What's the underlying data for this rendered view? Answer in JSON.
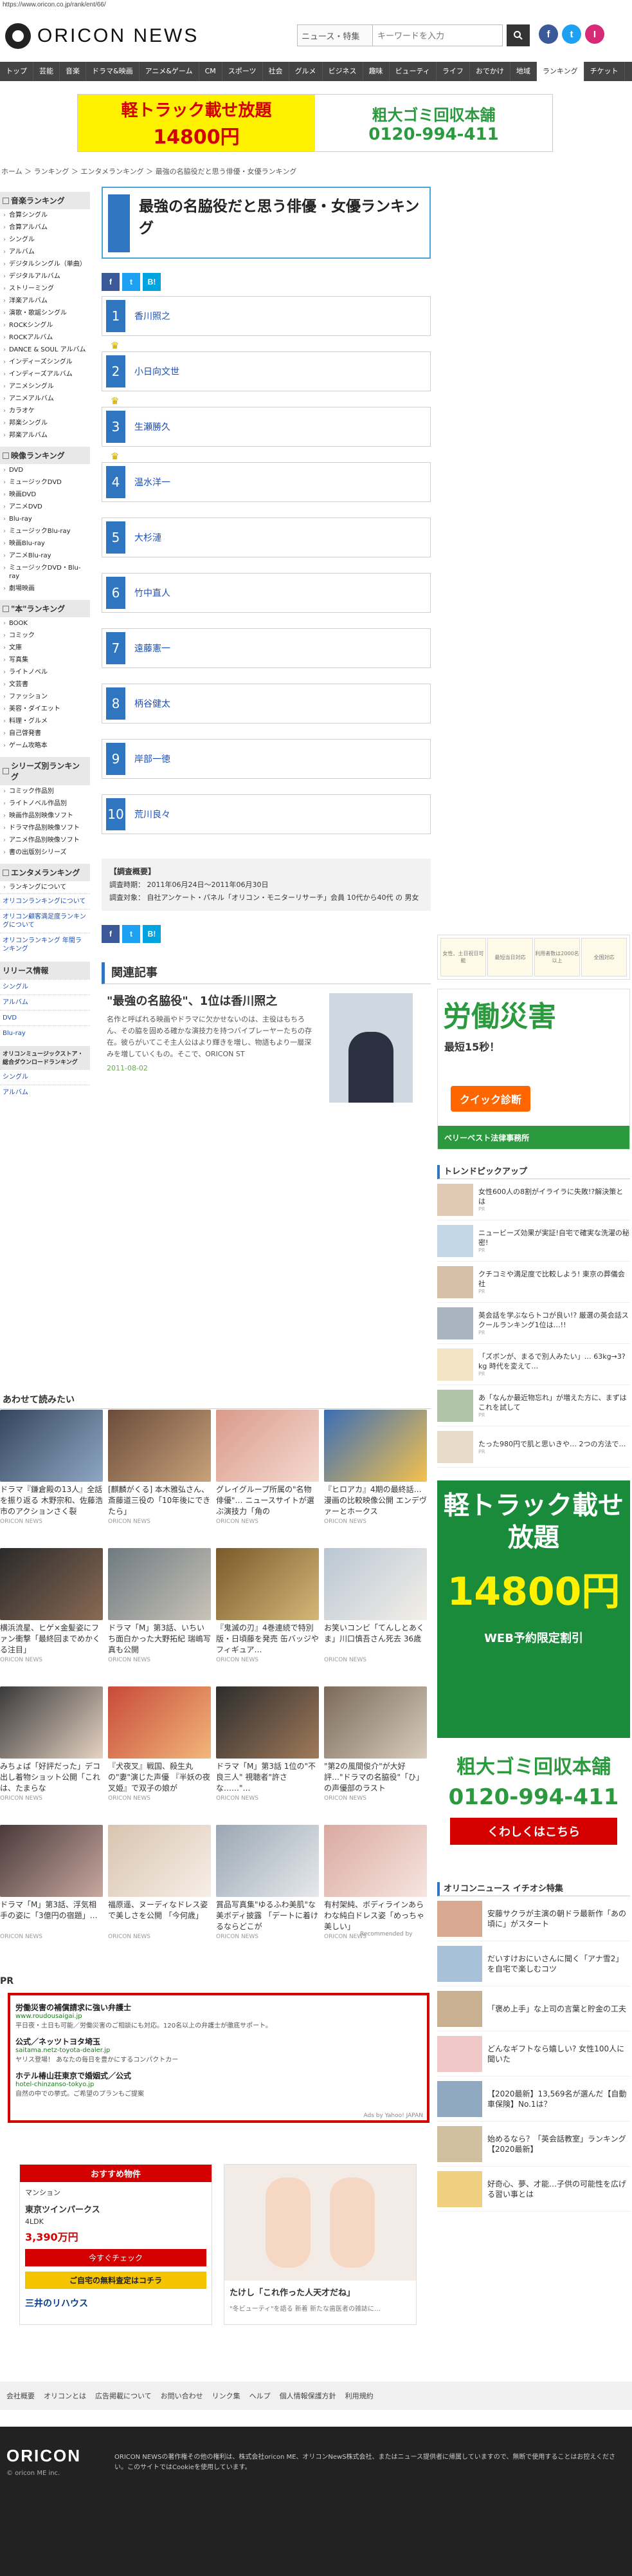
{
  "url": "https://www.oricon.co.jp/rank/ent/66/",
  "site": {
    "logo": "ORICON NEWS",
    "search_select": "ニュース・特集",
    "search_placeholder": "キーワードを入力",
    "search_icon": "search-icon"
  },
  "social": [
    "f",
    "t",
    "I"
  ],
  "nav": [
    "トップ",
    "芸能",
    "音楽",
    "ドラマ&映画",
    "アニメ&ゲーム",
    "CM",
    "スポーツ",
    "社会",
    "グルメ",
    "ビジネス",
    "趣味",
    "ビューティ",
    "ライフ",
    "おでかけ",
    "地域",
    "ランキング",
    "チケット"
  ],
  "nav_active": "ランキング",
  "ad_top": {
    "left_title": "軽トラック載せ放題",
    "left_price": "14800円",
    "right_title": "粗大ゴミ回収本舗",
    "right_tel": "0120-994-411"
  },
  "breadcrumb": "ホーム ＞ ランキング ＞ エンタメランキング ＞ 最強の名脇役だと思う俳優・女優ランキング",
  "sidebar": [
    {
      "head": "音楽ランキング",
      "items": [
        "合算シングル",
        "合算アルバム",
        "シングル",
        "アルバム",
        "デジタルシングル（単曲）",
        "デジタルアルバム",
        "ストリーミング",
        "洋楽アルバム",
        "演歌・歌謡シングル",
        "ROCKシングル",
        "ROCKアルバム",
        "DANCE & SOUL アルバム",
        "インディーズシングル",
        "インディーズアルバム",
        "アニメシングル",
        "アニメアルバム",
        "カラオケ",
        "邦楽シングル",
        "邦楽アルバム"
      ]
    },
    {
      "head": "映像ランキング",
      "items": [
        "DVD",
        "ミュージックDVD",
        "映画DVD",
        "アニメDVD",
        "Blu-ray",
        "ミュージックBlu-ray",
        "映画Blu-ray",
        "アニメBlu-ray",
        "ミュージックDVD・Blu-ray",
        "劇場映画"
      ]
    },
    {
      "head": "\"本\"ランキング",
      "items": [
        "BOOK",
        "コミック",
        "文庫",
        "写真集",
        "ライトノベル",
        "文芸書",
        "ファッション",
        "美容・ダイエット",
        "料理・グルメ",
        "自己啓発書",
        "ゲーム攻略本"
      ]
    },
    {
      "head": "シリーズ別ランキング",
      "items": [
        "コミック作品別",
        "ライトノベル作品別",
        "映画作品別映像ソフト",
        "ドラマ作品別映像ソフト",
        "アニメ作品別映像ソフト",
        "書の出版別シリーズ"
      ]
    },
    {
      "head": "エンタメランキング",
      "items": [
        "ランキングについて"
      ]
    }
  ],
  "sidebar_links": [
    "オリコンランキングについて",
    "オリコン顧客満足度ランキングについて",
    "オリコンランキング 年間ランキング"
  ],
  "sidebar_video": {
    "head": "リリース情報",
    "items": [
      "シングル",
      "アルバム",
      "DVD",
      "Blu-ray"
    ],
    "extra": "オリコンミュージックストア・総合ダウンロードランキング",
    "extra_items": [
      "シングル",
      "アルバム"
    ]
  },
  "page": {
    "title": "最強の名脇役だと思う俳優・女優ランキング"
  },
  "share": [
    "f",
    "t",
    "B!"
  ],
  "ranking": [
    {
      "rank": "1",
      "name": "香川照之",
      "crown": true
    },
    {
      "rank": "2",
      "name": "小日向文世",
      "crown": true
    },
    {
      "rank": "3",
      "name": "生瀬勝久",
      "crown": true
    },
    {
      "rank": "4",
      "name": "温水洋一",
      "crown": false
    },
    {
      "rank": "5",
      "name": "大杉漣",
      "crown": false
    },
    {
      "rank": "6",
      "name": "竹中直人",
      "crown": false
    },
    {
      "rank": "7",
      "name": "遠藤憲一",
      "crown": false
    },
    {
      "rank": "8",
      "name": "柄谷健太",
      "crown": false
    },
    {
      "rank": "9",
      "name": "岸部一徳",
      "crown": false
    },
    {
      "rank": "10",
      "name": "荒川良々",
      "crown": false
    }
  ],
  "survey": {
    "head": "【調査概要】",
    "period": "調査時期： 2011年06月24日〜2011年06月30日",
    "target": "調査対象： 自社アンケート・パネル「オリコン・モニターリサーチ」会員 10代から40代 の 男女"
  },
  "related": {
    "head": "関連記事",
    "title": "\"最強の名脇役\"、1位は香川照之",
    "body": "名作と呼ばれる映画やドラマに欠かせないのは、主役はもちろん、その脇を固める確かな演技力を持つバイプレーヤーたちの存在。彼らがいてこそ主人公はより輝きを増し、物語もより一層深みを増していくもの。そこで、ORICON ST",
    "date": "2011-08-02"
  },
  "suggest": {
    "head": "あわせて読みたい",
    "recommended": "Recommended by",
    "items": [
      {
        "cap": "ドラマ『鎌倉殿の13人』全話を振り返る 木野宗和、佐藤浩市のアクションさく裂",
        "src": "ORICON NEWS",
        "c1": "#34465e",
        "c2": "#8fa7c4"
      },
      {
        "cap": "[麒麟がくる] 本木雅弘さん、斎藤道三役の「10年後にできたら」",
        "src": "ORICON NEWS",
        "c1": "#6b4c3b",
        "c2": "#c8a27a"
      },
      {
        "cap": "グレイグループ所属の\"名物俳優\"… ニュースサイトが選ぶ演技力「角の",
        "src": "ORICON NEWS",
        "c1": "#d99a8b",
        "c2": "#f5d9cf"
      },
      {
        "cap": "『ヒロアカ』4期の最終話…漫画の比較映像公開 エンデヴァーとホークス",
        "src": "ORICON NEWS",
        "c1": "#3b6db5",
        "c2": "#f4c24d"
      },
      {
        "cap": "横浜流星、ヒゲ×金髪姿にファン衝撃「最終回までめかくる注目」",
        "src": "ORICON NEWS",
        "c1": "#2a2a2a",
        "c2": "#8a6a55"
      },
      {
        "cap": "ドラマ「M」第3話、いちいち面白かった大野拓紀 瑞嶋写真も公開",
        "src": "ORICON NEWS",
        "c1": "#6e7a80",
        "c2": "#c9c3b8"
      },
      {
        "cap": "『鬼滅の刃』4巻連続で特別版・日頃藤を発売 缶バッジやフィギュア…",
        "src": "ORICON NEWS",
        "c1": "#7a5a2a",
        "c2": "#d4b87a"
      },
      {
        "cap": "お笑いコンビ「てんしとあくま」川口慎吾さん死去 36歳",
        "src": "ORICON NEWS",
        "c1": "#b9c6d3",
        "c2": "#f3efe8"
      },
      {
        "cap": "みちょぱ「好評だった」デコ出し着物ショット公開「これは、たまらな",
        "src": "ORICON NEWS",
        "c1": "#3a3a3a",
        "c2": "#e6d3c2"
      },
      {
        "cap": "『犬夜叉』戦国、殺生丸の\"妻\"演じた声優 『半妖の夜叉姫』で双子の娘が",
        "src": "ORICON NEWS",
        "c1": "#c84a3a",
        "c2": "#f2b77a"
      },
      {
        "cap": "ドラマ「M」第3話 1位の\"不良三人\" 視聴者\"許さな……\"…",
        "src": "ORICON NEWS",
        "c1": "#2d2d2d",
        "c2": "#a07a5a"
      },
      {
        "cap": "\"第2の風間俊介\"が大好評…\"ドラマの名脇役\"「ひ」の声優部のラスト",
        "src": "ORICON NEWS",
        "c1": "#7a6a5a",
        "c2": "#d8ccbc"
      },
      {
        "cap": "ドラマ「M」第3話、浮気相手の姿に「3億円の宿題」…",
        "src": "ORICON NEWS",
        "c1": "#4a3a3a",
        "c2": "#c8a8a0"
      },
      {
        "cap": "福原遥、ヌーディなドレス姿で美しさを公開 「今何歳」",
        "src": "ORICON NEWS",
        "c1": "#d8c4b0",
        "c2": "#f6eee6"
      },
      {
        "cap": "賞品写真集\"ゆるふわ美肌\"な美ボディ披露 「デートに着けるならどこが",
        "src": "ORICON NEWS",
        "c1": "#9aa7b3",
        "c2": "#e6e9ec"
      },
      {
        "cap": "有村架純、ボディラインあらわな純白ドレス姿「めっちゃ美しい」",
        "src": "ORICON NEWS",
        "c1": "#d9a9a0",
        "c2": "#f7e6e0"
      }
    ]
  },
  "pr": {
    "head": "PR",
    "items": [
      {
        "t": "労働災害の補償請求に強い弁護士",
        "u": "www.roudousaigai.jp",
        "d": "平日夜・土日も可能／労働災害のご相談にも対応。120名以上の弁護士が徹底サポート。"
      },
      {
        "t": "公式／ネッツトヨタ埼玉",
        "u": "saitama.netz-toyota-dealer.jp",
        "d": "ヤリス登場！ あなたの毎日を豊かにするコンパクトカー"
      },
      {
        "t": "ホテル椿山荘東京で婚姻式／公式",
        "u": "hotel-chinzanso-tokyo.jp",
        "d": "自然の中での挙式。ご希望のプランもご提案"
      }
    ],
    "ads_by": "Ads by Yahoo! JAPAN"
  },
  "ad_bottom_l": {
    "head": "おすすめ物件",
    "type": "マンション",
    "name": "東京ツインパークス",
    "layout": "4LDK",
    "price": "3,390万円",
    "btn": "今すぐチェック",
    "btn2": "ご自宅の無料査定はコチラ",
    "brand": "三井のリハウス"
  },
  "ad_bottom_r": {
    "caption": "たけし「これ作った人天才だね」",
    "sub": "\"冬ビューティ\"を語る 新着 新たな歯医者の雑誌に…"
  },
  "right": {
    "topbox": [
      "女性、土日祝日可能",
      "最短当日対応",
      "利用者数は2000名以上",
      "全国対応"
    ],
    "ad1": {
      "h": "労働災害",
      "sub": "最短15秒！",
      "btn": "クイック診断",
      "foot": "ベリーベスト法律事務所"
    },
    "trend_head": "トレンドピックアップ",
    "trends": [
      {
        "t": "女性600人の8割がイライラに失敗!?解決策とは",
        "src": "PR",
        "c": "#e0c9b5"
      },
      {
        "t": "ニュービーズ効果が実証!自宅で確実な洗濯の秘密!",
        "src": "PR",
        "c": "#c4d7e8"
      },
      {
        "t": "クチコミや満足度で比較しよう! 東京の葬儀会社",
        "src": "PR",
        "c": "#d6c0a8"
      },
      {
        "t": "英会話を学ぶならトコが良い!? 厳選の英会話スクールランキング1位は…!!",
        "src": "PR",
        "c": "#a8b4c0"
      },
      {
        "t": "「ズボンが、まるで別人みたい」… 63kg→3?kg 時代を変えて…",
        "src": "PR",
        "c": "#f2e3c5"
      },
      {
        "t": "あ「なんか最近物忘れ」が増えた方に、まずはこれを試して",
        "src": "PR",
        "c": "#b0c4a8"
      },
      {
        "t": "たった980円で肌と思いきや… 2つの方法で…",
        "src": "PR",
        "c": "#e8dcc8"
      }
    ],
    "ad2": {
      "l1": "軽トラック載せ放題",
      "price": "14800円",
      "sub": "WEB予約限定割引",
      "cta": "粗大ゴミ回収本舗",
      "tel": "0120-994-411",
      "more": "くわしくはこちら"
    },
    "news_head": "オリコンニュース イチオシ特集",
    "news": [
      {
        "t": "安藤サクラが主演の朝ドラ最新作「あの頃に」がスタート",
        "c": "#d8a890"
      },
      {
        "t": "だいすけおにいさんに聞く「アナ雪2」を自宅で楽しむコツ",
        "c": "#a8c0d8"
      },
      {
        "t": "「褒め上手」な上司の言葉と貯金の工夫",
        "c": "#c8b090"
      },
      {
        "t": "どんなギフトなら嬉しい? 女性100人に聞いた",
        "c": "#f0c8c8"
      },
      {
        "t": "【2020最新】13,569名が選んだ【自動車保険】No.1は？",
        "c": "#90a8c0"
      },
      {
        "t": "始めるなら？「英会話教室」ランキング【2020最新】",
        "c": "#d0c0a0"
      },
      {
        "t": "好奇心、夢、才能…子供の可能性を広げる習い事とは",
        "c": "#f0d080"
      }
    ]
  },
  "footer_nav": [
    "会社概要",
    "オリコンとは",
    "広告掲載について",
    "お問い合わせ",
    "リンク集",
    "ヘルプ",
    "個人情報保護方針",
    "利用規約"
  ],
  "footer": {
    "logo": "ORICON",
    "copy": "© oricon ME inc.",
    "text": "ORICON NEWSの著作権その他の権利は、株式会社oricon ME、オリコンNewS株式会社、またはニュース提供者に帰属していますので、無断で使用することはお控えください。このサイトではCookieを使用しています。"
  }
}
